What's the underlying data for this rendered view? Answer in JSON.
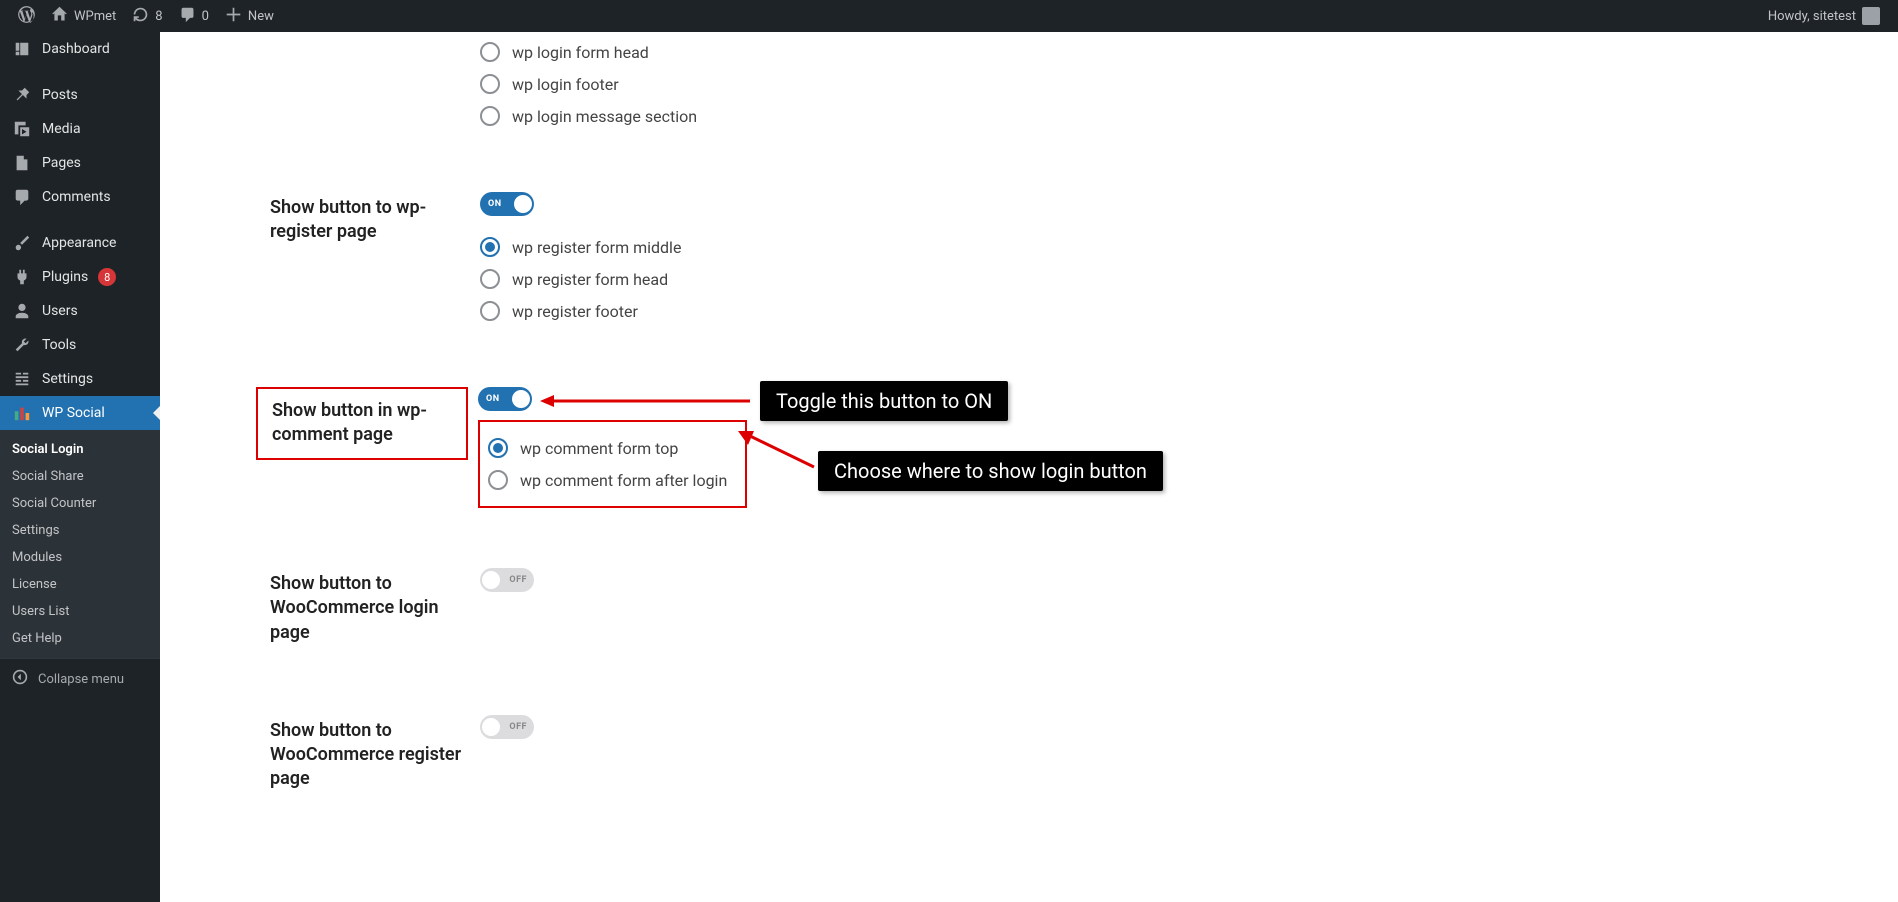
{
  "adminbar": {
    "site": "WPmet",
    "updates": "8",
    "comments": "0",
    "new": "New",
    "howdy": "Howdy, sitetest"
  },
  "menu": {
    "dashboard": "Dashboard",
    "posts": "Posts",
    "media": "Media",
    "pages": "Pages",
    "comments": "Comments",
    "appearance": "Appearance",
    "plugins": "Plugins",
    "plugins_badge": "8",
    "users": "Users",
    "tools": "Tools",
    "settings": "Settings",
    "wpsocial": "WP Social",
    "collapse": "Collapse menu"
  },
  "submenu": {
    "social_login": "Social Login",
    "social_share": "Social Share",
    "social_counter": "Social Counter",
    "settings": "Settings",
    "modules": "Modules",
    "license": "License",
    "users_list": "Users List",
    "get_help": "Get Help"
  },
  "settings": {
    "login_opts": {
      "form_head": "wp login form head",
      "footer": "wp login footer",
      "message": "wp login message section"
    },
    "register": {
      "label": "Show button to wp-register page",
      "opt_middle": "wp register form middle",
      "opt_head": "wp register form head",
      "opt_footer": "wp register footer"
    },
    "comment": {
      "label": "Show button in wp-comment page",
      "opt_top": "wp comment form top",
      "opt_after": "wp comment form after login"
    },
    "woo_login": {
      "label": "Show button to WooCommerce login page"
    },
    "woo_register": {
      "label": "Show button to WooCommerce register page"
    },
    "toggle_on": "ON",
    "toggle_off": "OFF"
  },
  "annotations": {
    "toggle": "Toggle this button to ON",
    "choose": "Choose where to show login button"
  }
}
